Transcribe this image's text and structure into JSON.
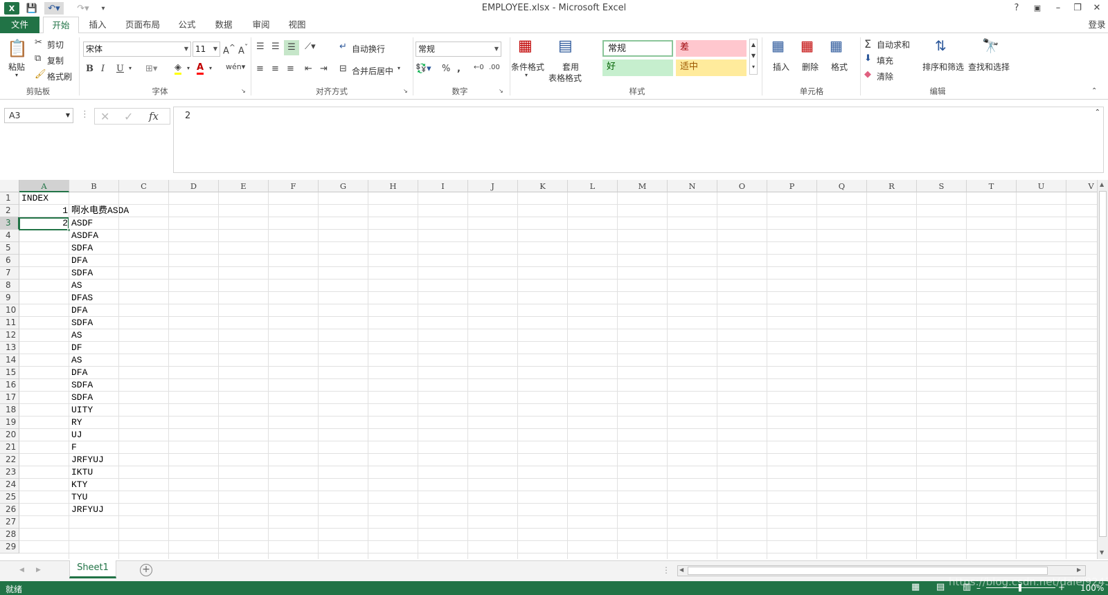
{
  "window": {
    "title": "EMPLOYEE.xlsx - Microsoft Excel",
    "help": "?",
    "minimize": "–",
    "restore": "❐",
    "close": "✕",
    "login": "登录"
  },
  "tabs": [
    "文件",
    "开始",
    "插入",
    "页面布局",
    "公式",
    "数据",
    "审阅",
    "视图"
  ],
  "active_tab": "开始",
  "ribbon": {
    "clipboard": {
      "label": "剪贴板",
      "paste": "粘贴",
      "cut": "剪切",
      "copy": "复制",
      "format_painter": "格式刷"
    },
    "font": {
      "label": "字体",
      "name": "宋体",
      "size": "11",
      "bold": "B",
      "italic": "I",
      "underline": "U"
    },
    "alignment": {
      "label": "对齐方式",
      "wrap": "自动换行",
      "merge": "合并后居中"
    },
    "number": {
      "label": "数字",
      "format": "常规",
      "percent": "%",
      "comma": ","
    },
    "styles": {
      "label": "样式",
      "conditional": "条件格式",
      "table_format_1": "套用",
      "table_format_2": "表格格式",
      "normal": "常规",
      "bad": "差",
      "good": "好",
      "neutral": "适中"
    },
    "cells": {
      "label": "单元格",
      "insert": "插入",
      "delete": "删除",
      "format": "格式"
    },
    "editing": {
      "label": "编辑",
      "autosum": "自动求和",
      "fill": "填充",
      "clear": "清除",
      "sort_filter": "排序和筛选",
      "find_select": "查找和选择"
    }
  },
  "formula_bar": {
    "name_box": "A3",
    "fx": "fx",
    "content": "2"
  },
  "columns": [
    "A",
    "B",
    "C",
    "D",
    "E",
    "F",
    "G",
    "H",
    "I",
    "J",
    "K",
    "L",
    "M",
    "N",
    "O",
    "P",
    "Q",
    "R",
    "S",
    "T",
    "U",
    "V"
  ],
  "selected_column": "A",
  "selected_row": 3,
  "rows": [
    {
      "n": "1",
      "a": "INDEX",
      "b": ""
    },
    {
      "n": "2",
      "a": "1",
      "b": "啊水电费ASDA"
    },
    {
      "n": "3",
      "a": "2",
      "b": "ASDF"
    },
    {
      "n": "4",
      "a": "",
      "b": "ASDFA"
    },
    {
      "n": "5",
      "a": "",
      "b": "SDFA"
    },
    {
      "n": "6",
      "a": "",
      "b": "DFA"
    },
    {
      "n": "7",
      "a": "",
      "b": "SDFA"
    },
    {
      "n": "8",
      "a": "",
      "b": "AS"
    },
    {
      "n": "9",
      "a": "",
      "b": "DFAS"
    },
    {
      "n": "10",
      "a": "",
      "b": "DFA"
    },
    {
      "n": "11",
      "a": "",
      "b": "SDFA"
    },
    {
      "n": "12",
      "a": "",
      "b": "AS"
    },
    {
      "n": "13",
      "a": "",
      "b": "DF"
    },
    {
      "n": "14",
      "a": "",
      "b": "AS"
    },
    {
      "n": "15",
      "a": "",
      "b": "DFA"
    },
    {
      "n": "16",
      "a": "",
      "b": "SDFA"
    },
    {
      "n": "17",
      "a": "",
      "b": "SDFA"
    },
    {
      "n": "18",
      "a": "",
      "b": "UITY"
    },
    {
      "n": "19",
      "a": "",
      "b": "RY"
    },
    {
      "n": "20",
      "a": "",
      "b": "UJ"
    },
    {
      "n": "21",
      "a": "",
      "b": "F"
    },
    {
      "n": "22",
      "a": "",
      "b": "JRFYUJ"
    },
    {
      "n": "23",
      "a": "",
      "b": "IKTU"
    },
    {
      "n": "24",
      "a": "",
      "b": "KTY"
    },
    {
      "n": "25",
      "a": "",
      "b": "TYU"
    },
    {
      "n": "26",
      "a": "",
      "b": "JRFYUJ"
    },
    {
      "n": "27",
      "a": "",
      "b": ""
    },
    {
      "n": "28",
      "a": "",
      "b": ""
    },
    {
      "n": "29",
      "a": "",
      "b": ""
    }
  ],
  "sheets": [
    "Sheet1"
  ],
  "status": {
    "ready": "就绪",
    "zoom": "100%",
    "watermark": "https://blog.csdn.net/daiei9243"
  },
  "colors": {
    "accent": "#217346",
    "bad_bg": "#ffc7ce",
    "bad_fg": "#9c0006",
    "good_bg": "#c6efce",
    "good_fg": "#006100",
    "neutral_bg": "#ffeb9c",
    "neutral_fg": "#9c5700"
  }
}
